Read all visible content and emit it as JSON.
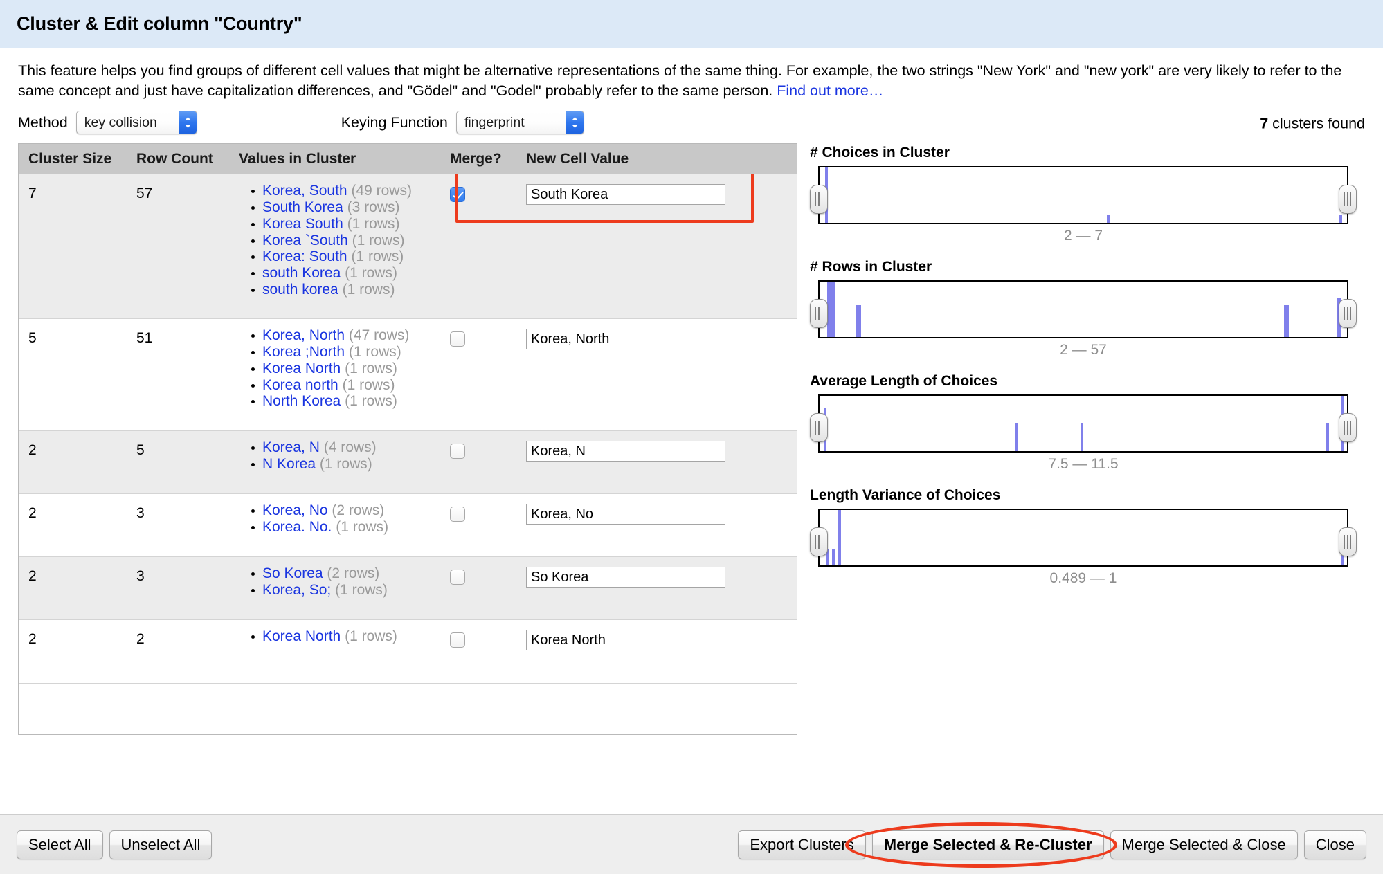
{
  "dialog": {
    "title": "Cluster & Edit column \"Country\"",
    "description_part1": "This feature helps you find groups of different cell values that might be alternative representations of the same thing. For example, the two strings \"New York\" and \"new york\" are very likely to refer to the same concept and just have capitalization differences, and \"Gödel\" and \"Godel\" probably refer to the same person. ",
    "find_out_more": "Find out more…"
  },
  "controls": {
    "method_label": "Method",
    "method_value": "key collision",
    "keying_label": "Keying Function",
    "keying_value": "fingerprint",
    "clusters_found_count": "7",
    "clusters_found_suffix": " clusters found"
  },
  "table": {
    "headers": {
      "cluster_size": "Cluster Size",
      "row_count": "Row Count",
      "values_in_cluster": "Values in Cluster",
      "merge": "Merge?",
      "new_cell_value": "New Cell Value"
    },
    "rows": [
      {
        "cluster_size": "7",
        "row_count": "57",
        "values": [
          {
            "value": "Korea, South",
            "count": "(49 rows)"
          },
          {
            "value": "South Korea",
            "count": "(3 rows)"
          },
          {
            "value": "Korea South",
            "count": "(1 rows)"
          },
          {
            "value": "Korea `South",
            "count": "(1 rows)"
          },
          {
            "value": "Korea: South",
            "count": "(1 rows)"
          },
          {
            "value": "south Korea",
            "count": "(1 rows)"
          },
          {
            "value": "south korea",
            "count": "(1 rows)"
          }
        ],
        "merge_checked": true,
        "new_cell_value": "South Korea"
      },
      {
        "cluster_size": "5",
        "row_count": "51",
        "values": [
          {
            "value": "Korea, North",
            "count": "(47 rows)"
          },
          {
            "value": "Korea ;North",
            "count": "(1 rows)"
          },
          {
            "value": "Korea North",
            "count": "(1 rows)"
          },
          {
            "value": "Korea north",
            "count": "(1 rows)"
          },
          {
            "value": "North Korea",
            "count": "(1 rows)"
          }
        ],
        "merge_checked": false,
        "new_cell_value": "Korea, North"
      },
      {
        "cluster_size": "2",
        "row_count": "5",
        "values": [
          {
            "value": "Korea, N",
            "count": "(4 rows)"
          },
          {
            "value": "N Korea",
            "count": "(1 rows)"
          }
        ],
        "merge_checked": false,
        "new_cell_value": "Korea, N"
      },
      {
        "cluster_size": "2",
        "row_count": "3",
        "values": [
          {
            "value": "Korea, No",
            "count": "(2 rows)"
          },
          {
            "value": "Korea. No.",
            "count": "(1 rows)"
          }
        ],
        "merge_checked": false,
        "new_cell_value": "Korea, No"
      },
      {
        "cluster_size": "2",
        "row_count": "3",
        "values": [
          {
            "value": "So Korea",
            "count": "(2 rows)"
          },
          {
            "value": "Korea, So;",
            "count": "(1 rows)"
          }
        ],
        "merge_checked": false,
        "new_cell_value": "So Korea"
      },
      {
        "cluster_size": "2",
        "row_count": "2",
        "values": [
          {
            "value": "Korea North",
            "count": "(1 rows)"
          }
        ],
        "merge_checked": false,
        "new_cell_value": "Korea North"
      }
    ]
  },
  "chart_data": [
    {
      "type": "bar",
      "title": "# Choices in Cluster",
      "range_label": "2 — 7",
      "axis_min": 2,
      "axis_max": 7,
      "bars": [
        {
          "pos_pct": 1.0,
          "height_pct": 100
        },
        {
          "pos_pct": 54.5,
          "height_pct": 14
        },
        {
          "pos_pct": 98.5,
          "height_pct": 14
        }
      ],
      "slider_left_pct": 0,
      "slider_right_pct": 100
    },
    {
      "type": "bar",
      "title": "# Rows in Cluster",
      "range_label": "2 — 57",
      "axis_min": 2,
      "axis_max": 57,
      "bars": [
        {
          "pos_pct": 1.5,
          "height_pct": 100,
          "width": 12
        },
        {
          "pos_pct": 7.0,
          "height_pct": 58,
          "width": 7
        },
        {
          "pos_pct": 88.0,
          "height_pct": 58,
          "width": 7
        },
        {
          "pos_pct": 98.0,
          "height_pct": 72,
          "width": 7
        }
      ],
      "slider_left_pct": 0,
      "slider_right_pct": 100
    },
    {
      "type": "bar",
      "title": "Average Length of Choices",
      "range_label": "7.5 — 11.5",
      "axis_min": 7.5,
      "axis_max": 11.5,
      "bars": [
        {
          "pos_pct": 0.8,
          "height_pct": 78
        },
        {
          "pos_pct": 37.0,
          "height_pct": 52
        },
        {
          "pos_pct": 49.5,
          "height_pct": 52
        },
        {
          "pos_pct": 96.0,
          "height_pct": 52
        },
        {
          "pos_pct": 99.0,
          "height_pct": 100
        }
      ],
      "slider_left_pct": 0,
      "slider_right_pct": 100
    },
    {
      "type": "bar",
      "title": "Length Variance of Choices",
      "range_label": "0.489 — 1",
      "axis_min": 0.489,
      "axis_max": 1,
      "bars": [
        {
          "pos_pct": 1.2,
          "height_pct": 30
        },
        {
          "pos_pct": 2.4,
          "height_pct": 30
        },
        {
          "pos_pct": 3.6,
          "height_pct": 100
        },
        {
          "pos_pct": 98.8,
          "height_pct": 30
        }
      ],
      "slider_left_pct": 0,
      "slider_right_pct": 100
    }
  ],
  "footer": {
    "select_all": "Select All",
    "unselect_all": "Unselect All",
    "export_clusters": "Export Clusters",
    "merge_recluster": "Merge Selected & Re-Cluster",
    "merge_close": "Merge Selected & Close",
    "close": "Close"
  }
}
